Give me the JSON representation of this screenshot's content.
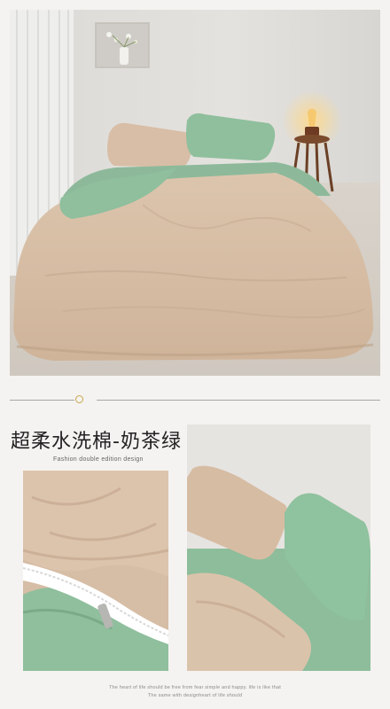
{
  "product": {
    "title": "超柔水洗棉-奶茶绿",
    "subtitle": "Fashion double edition design"
  },
  "footer": {
    "line1": "The heart of life should be free from fear simple and happy. life is like that",
    "line2": "The same with designheart of life should"
  },
  "colors": {
    "khaki": "#d9c0a8",
    "sage_green": "#8fbf9d",
    "background": "#f4f3f1",
    "accent_gold": "#c9a64b"
  }
}
